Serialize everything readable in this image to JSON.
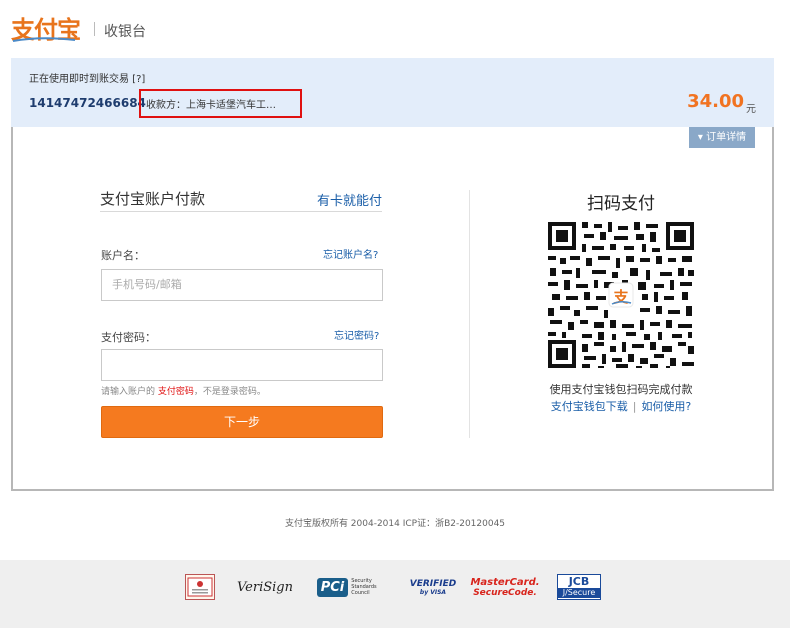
{
  "header": {
    "logo": "支付宝",
    "section": "收银台"
  },
  "order": {
    "type": "正在使用即时到账交易 [?]",
    "number": "14147472466684",
    "payee": "收款方：上海卡适堡汽车工…",
    "amount": "34.00",
    "currency": "元",
    "detail_toggle": "▾ 订单详情"
  },
  "account_pay": {
    "title": "支付宝账户付款",
    "card_link": "有卡就能付",
    "account_label": "账户名：",
    "forgot_account": "忘记账户名?",
    "account_placeholder": "手机号码/邮箱",
    "password_label": "支付密码：",
    "forgot_password": "忘记密码?",
    "hint_prefix": "请输入账户的 ",
    "hint_highlight": "支付密码",
    "hint_suffix": "，不是登录密码。",
    "next_button": "下一步"
  },
  "qr_pay": {
    "title": "扫码支付",
    "description": "使用支付宝钱包扫码完成付款",
    "download_link": "支付宝钱包下载",
    "separator": "|",
    "howto_link": "如何使用?"
  },
  "footer": {
    "copyright": "支付宝版权所有 2004-2014 ICP证：浙B2-20120045",
    "badges": {
      "verisign": "VeriSign",
      "pci": "PCi",
      "pci_text": "Security Standards Council",
      "visa_1": "VERIFIED",
      "visa_2": "by VISA",
      "mc_1": "MasterCard.",
      "mc_2": "SecureCode.",
      "jcb_1": "JCB",
      "jcb_2": "J/Secure"
    }
  }
}
